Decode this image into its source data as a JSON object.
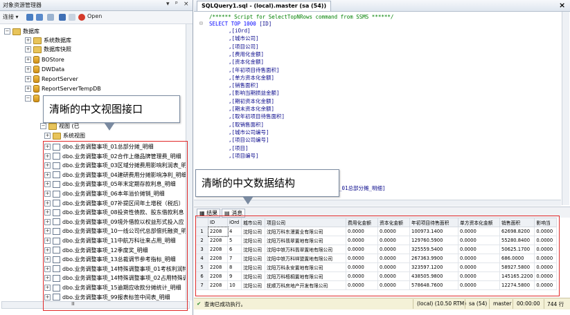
{
  "left_panel": {
    "title": "对象资源管理器",
    "title_controls": [
      "▾",
      "ᵖ",
      "×"
    ],
    "toolbar": {
      "connect_label": "连接 ▾",
      "open_label": "Open"
    },
    "tree": [
      {
        "label": "数据库",
        "icon": "folder",
        "expander": "−",
        "level": 0
      },
      {
        "label": "系统数据库",
        "icon": "folder",
        "expander": "+",
        "level": 1
      },
      {
        "label": "数据库快照",
        "icon": "folder",
        "expander": "+",
        "level": 1
      },
      {
        "label": "BOStore",
        "icon": "database",
        "expander": "+",
        "level": 1
      },
      {
        "label": "DWData",
        "icon": "database",
        "expander": "+",
        "level": 1
      },
      {
        "label": "ReportServer",
        "icon": "database",
        "expander": "+",
        "level": 1
      },
      {
        "label": "ReportServerTempDB",
        "icon": "database",
        "expander": "+",
        "level": 1
      },
      {
        "label": "视图 (已",
        "icon": "folder",
        "expander": "−",
        "level": 2
      },
      {
        "label": "系统视图",
        "icon": "folder",
        "expander": "+",
        "level": 3
      }
    ],
    "views": [
      "dbo.业务调整事项_01总部分摊_明细",
      "dbo.业务调整事项_02合作上缴品牌管理费_明细",
      "dbo.业务调整事项_03区域分摊费用影响利润表_明",
      "dbo.业务调整事项_04建研费用分摊影响净利_明细",
      "dbo.业务调整事项_05年末定期存款利息_明细",
      "dbo.业务调整事项_06本年溢价摊销_明细",
      "dbo.业务调整事项_07补提区间年土增税（税后）",
      "dbo.业务调整事项_08投资性债款、股东借款利息",
      "dbo.业务调整事项_09境外借款以权益形式投入应",
      "dbo.业务调整事项_10一线公司代总部偿托融资_明",
      "dbo.业务调整事项_11中航万科往来占用_明细",
      "dbo.业务调整事项_12季度奖_明细",
      "dbo.业务调整事项_13总裁调节参考指标_明细",
      "dbo.业务调整事项_14特殊调整事项_01考核利润特",
      "dbo.业务调整事项_14特殊调整事项_02占用特殊调",
      "dbo.业务调整事项_15逾期应收款分摊统计_明细",
      "dbo.业务调整事项_99报表标签中间表_明细"
    ],
    "hscroll_label": "Ⅲ"
  },
  "editor": {
    "tab_title": "SQLQuery1.sql - (local).master (sa (54))",
    "tab_close": "×",
    "comment": "/****** Script for SelectTopNRows command from SSMS  ******/",
    "select_keyword": "SELECT TOP 1000",
    "first_col": "[ID]",
    "columns": [
      ",[iOrd]",
      ",[城市公司]",
      ",[项目公司]",
      ",[费用化金额]",
      ",[资本化金额]",
      ",[年初项目待售面积]",
      ",[单方资本化金额]",
      ",[销售面积]",
      ",[影响当期损益金额]",
      ",[期初资本化金额]",
      ",[期末资本化余额]",
      ",[取年初项目待售面积]",
      ",[取销售面积]",
      ",[城市公司编号]",
      ",[项目公司编号]",
      ",[项目]",
      ",[项目编号]"
    ],
    "from_fragment": "事项_01总部分摊_明细]"
  },
  "results": {
    "tabs": [
      "结果",
      "消息"
    ],
    "columns": [
      "",
      "ID",
      "iOrd",
      "城市公司",
      "项目公司",
      "费用化金额",
      "资本化金额",
      "年初项目待售面积",
      "单方资本化金额",
      "销售面积",
      "影响当"
    ],
    "rows": [
      [
        "1",
        "2208",
        "4",
        "沈阳公司",
        "沈阳万科东漫置业有限公司",
        "0.0000",
        "0.0000",
        "100973.1400",
        "0.0000",
        "62698.8200",
        "0.0000"
      ],
      [
        "2",
        "2208",
        "5",
        "沈阳公司",
        "沈阳万科翡翠置地有限公司",
        "0.0000",
        "0.0000",
        "129760.5900",
        "0.0000",
        "55280.8400",
        "0.0000"
      ],
      [
        "3",
        "2208",
        "6",
        "沈阳公司",
        "沈阳中铁万科翡翠置地有限公司",
        "0.0000",
        "0.0000",
        "325559.5400",
        "0.0000",
        "50625.1700",
        "0.0000"
      ],
      [
        "4",
        "2208",
        "7",
        "沈阳公司",
        "沈阳中铁万科祥盟置地有限公司",
        "0.0000",
        "0.0000",
        "267363.9900",
        "0.0000",
        "686.0000",
        "0.0000"
      ],
      [
        "5",
        "2208",
        "8",
        "沈阳公司",
        "沈阳万科永安置地有限公司",
        "0.0000",
        "0.0000",
        "323597.1200",
        "0.0000",
        "58927.5800",
        "0.0000"
      ],
      [
        "6",
        "2208",
        "9",
        "沈阳公司",
        "沈阳万科梧桐置地有限公司",
        "0.0000",
        "0.0000",
        "438505.9800",
        "0.0000",
        "145165.2200",
        "0.0000"
      ],
      [
        "7",
        "2208",
        "10",
        "沈阳公司",
        "抚顺万科房地产开发有限公司",
        "0.0000",
        "0.0000",
        "578648.7600",
        "0.0000",
        "12274.5800",
        "0.0000"
      ]
    ]
  },
  "status": {
    "message": "查询已成功执行。",
    "server": "(local) (10.50 RTM)",
    "user": "sa (54)",
    "database": "master",
    "time": "00:00:00",
    "rows": "744 行"
  },
  "callouts": {
    "view_interface": "清晰的中文视图接口",
    "data_structure": "清晰的中文数据结构"
  }
}
